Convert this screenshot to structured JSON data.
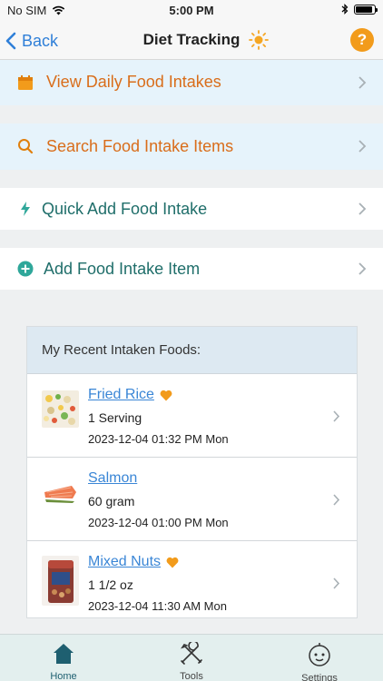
{
  "status_bar": {
    "carrier": "No SIM",
    "time": "5:00 PM",
    "battery_level": 0.9
  },
  "nav": {
    "back_label": "Back",
    "title": "Diet Tracking",
    "help_label": "?"
  },
  "menu": [
    {
      "label": "View Daily Food Intakes",
      "icon": "calendar-icon"
    },
    {
      "label": "Search Food Intake Items",
      "icon": "search-icon"
    },
    {
      "label": "Quick Add Food Intake",
      "icon": "bolt-icon"
    },
    {
      "label": "Add Food Intake Item",
      "icon": "plus-circle-icon"
    }
  ],
  "recent": {
    "header": "My Recent Intaken Foods:",
    "items": [
      {
        "name": "Fried Rice",
        "favorite": true,
        "quantity": "1 Serving",
        "time": "2023-12-04 01:32 PM Mon",
        "thumb": "fried-rice-thumbnail"
      },
      {
        "name": "Salmon",
        "favorite": false,
        "quantity": "60 gram",
        "time": "2023-12-04 01:00 PM Mon",
        "thumb": "salmon-thumbnail"
      },
      {
        "name": "Mixed Nuts",
        "favorite": true,
        "quantity": "1 1/2 oz",
        "time": "2023-12-04 11:30 AM Mon",
        "thumb": "mixed-nuts-thumbnail"
      }
    ]
  },
  "tabs": [
    {
      "label": "Home",
      "icon": "home-icon",
      "active": true
    },
    {
      "label": "Tools",
      "icon": "tools-icon",
      "active": false
    },
    {
      "label": "Settings",
      "icon": "settings-face-icon",
      "active": false
    }
  ],
  "colors": {
    "accent_blue": "#2f7fd8",
    "orange": "#d96d1a",
    "teal": "#1f6e6a",
    "help_orange": "#f29b1b",
    "heart": "#f29b1b"
  }
}
